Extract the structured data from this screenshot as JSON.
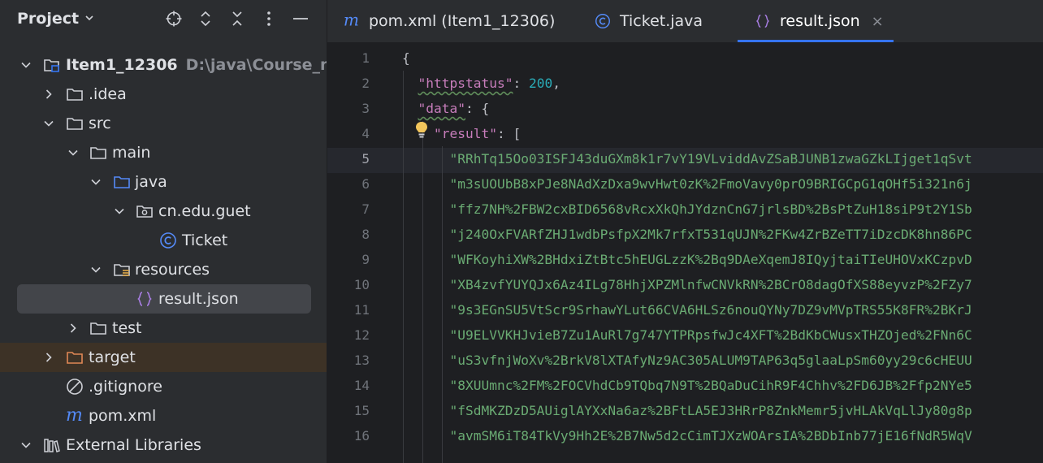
{
  "panel": {
    "title": "Project",
    "header_icons": [
      "locate-icon",
      "expand-collapse-icon",
      "collapse-all-icon",
      "more-icon",
      "minimize-icon"
    ]
  },
  "tree": [
    {
      "label": "Item1_12306",
      "path": "D:\\java\\Course_note",
      "icon": "module-folder-icon",
      "expanded": true,
      "bold": true
    },
    {
      "label": ".idea",
      "icon": "folder-icon",
      "expanded": false
    },
    {
      "label": "src",
      "icon": "folder-icon",
      "expanded": true
    },
    {
      "label": "main",
      "icon": "folder-icon",
      "expanded": true
    },
    {
      "label": "java",
      "icon": "source-folder-icon",
      "expanded": true
    },
    {
      "label": "cn.edu.guet",
      "icon": "package-icon",
      "expanded": true
    },
    {
      "label": "Ticket",
      "icon": "class-icon"
    },
    {
      "label": "resources",
      "icon": "resources-folder-icon",
      "expanded": true
    },
    {
      "label": "result.json",
      "icon": "json-icon",
      "selected": true
    },
    {
      "label": "test",
      "icon": "folder-icon",
      "expanded": false
    },
    {
      "label": "target",
      "icon": "excluded-folder-icon",
      "expanded": false
    },
    {
      "label": ".gitignore",
      "icon": "ignore-icon"
    },
    {
      "label": "pom.xml",
      "icon": "maven-icon"
    },
    {
      "label": "External Libraries",
      "icon": "library-icon",
      "expanded": true
    }
  ],
  "tabs": [
    {
      "label": "pom.xml (Item1_12306)",
      "icon": "maven-icon"
    },
    {
      "label": "Ticket.java",
      "icon": "class-icon"
    },
    {
      "label": "result.json",
      "icon": "json-icon",
      "active": true,
      "close": "×"
    }
  ],
  "editor": {
    "line_numbers": [
      "1",
      "2",
      "3",
      "4",
      "5",
      "6",
      "7",
      "8",
      "9",
      "10",
      "11",
      "12",
      "13",
      "14",
      "15",
      "16"
    ],
    "current_line": "5",
    "code": {
      "l1": "{",
      "l2_key": "\"httpstatus\"",
      "l2_colon": ": ",
      "l2_val": "200",
      "l2_end": ",",
      "l3_key": "\"data\"",
      "l3_end": ": {",
      "l4_key": "\"result\"",
      "l4_end": ": [",
      "strings": [
        "\"RRhTq15Oo03ISFJ43duGXm8k1r7vY19VLviddAvZSaBJUNB1zwaGZkLIjget1qSvt",
        "\"m3sUOUbB8xPJe8NAdXzDxa9wvHwt0zK%2FmoVavy0prO9BRIGCpG1qOHf5i321n6j",
        "\"ffz7NH%2FBW2cxBID6568vRcxXkQhJYdznCnG7jrlsBD%2BsPtZuH18siP9t2Y1Sb",
        "\"j240OxFVARfZHJ1wdbPsfpX2Mk7rfxT531qUJN%2FKw4ZrBZeTT7iDzcDK8hn86PC",
        "\"WFKoyhiXW%2BHdxiZtBtc5hEUGLzzK%2Bq9DAeXqemJ8IQyjtaiTIeUHOVxKCzpvD",
        "\"XB4zvfYUYQJx6Az4ILg78HhjXPZMlnfwCNVkRN%2BCrO8dagOfXS88eyvzP%2FZy7",
        "\"9s3EGnSU5VtScr9SrhawYLut66CVA6HLSz6nouQYNy7DZ9vMVpTRS55K8FR%2BKrJ",
        "\"U9ELVVKHJvieB7Zu1AuRl7g747YTPRpsfwJc4XFT%2BdKbCWusxTHZOjed%2FNn6C",
        "\"uS3vfnjWoXv%2BrkV8lXTAfyNz9AC305ALUM9TAP63q5glaaLpSm60yy29c6cHEUU",
        "\"8XUUmnc%2FM%2FOCVhdCb9TQbq7N9T%2BQaDuCihR9F4Chhv%2FD6JB%2Ffp2NYe5",
        "\"fSdMKZDzD5AUiglAYXxNa6az%2BFtLA5EJ3HRrP8ZnkMemr5jvHLAkVqLlJy80g8p",
        "\"avmSM6iT84TkVy9Hh2E%2B7Nw5d2cCimTJXzWOArsIA%2BDbInb77jE16fNdR5WqV"
      ]
    }
  },
  "colors": {
    "accent": "#3574f0",
    "json_key": "#c77dbb",
    "json_string": "#6aab73",
    "json_number": "#2aacb8",
    "bulb": "#f2c55c"
  }
}
